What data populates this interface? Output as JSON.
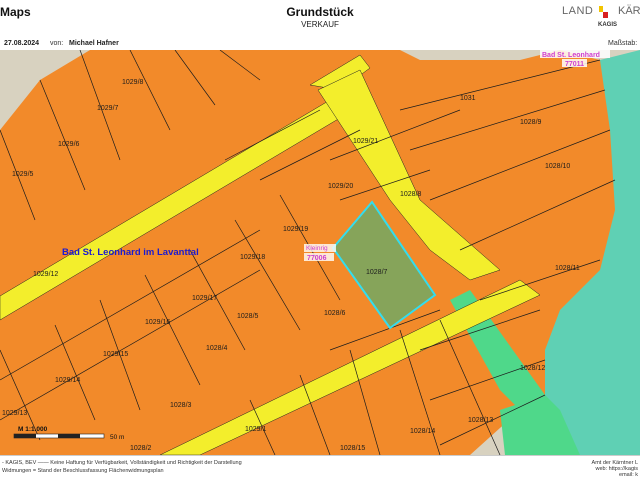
{
  "header": {
    "brand": "Maps",
    "title": "Grundstück",
    "subtitle": "VERKAUF",
    "date": "27.08.2024",
    "author_label": "von:",
    "author": "Michael Hafner",
    "scale_label": "Maßstab:",
    "logo_left": "LAND",
    "logo_right": "KÄR",
    "logo_sub": "KAGIS"
  },
  "map": {
    "town_label": "Bad St. Leonhard im Lavanttal",
    "cadastral_top": {
      "name": "Bad St. Leonhard",
      "code": "77011"
    },
    "cadastral_center": {
      "name": "Kleinrig",
      "code": "77006"
    },
    "selected_parcel": "1028/7",
    "parcels": [
      "1029/8",
      "1029/7",
      "1029/6",
      "1029/5",
      "1031",
      "1028/9",
      "1029/21",
      "1028/10",
      "1029/20",
      "1028/8",
      "1029/19",
      "1029/18",
      "1029/12",
      "1029/17",
      "1028/11",
      "1029/16",
      "1028/5",
      "1028/6",
      "1029/15",
      "1028/4",
      "1029/14",
      "1028/12",
      "1029/13",
      "1028/3",
      "1029/1",
      "1028/14",
      "1028/13",
      "1028/2",
      "1028/15"
    ],
    "scale_text": "M 1:1.000",
    "scale_dist": "50 m",
    "colors": {
      "parcel": "#f28a2a",
      "road": "#f3ee2c",
      "green": "#4fd88a",
      "teal": "#5fd0b4",
      "selected": "#86a45a",
      "selected_border": "#33ddee",
      "boundary": "#1c1c1c",
      "label_magenta": "#d040d0"
    }
  },
  "footer": {
    "left1": "- KAGIS, BEV —— Keine Haftung für Verfügbarkeit, Vollständigkeit und Richtigkeit der Darstellung",
    "left2": "Widmungen = Stand der Beschlussfassung Flächenwidmungsplan",
    "right1": "Amt der Kärntner L",
    "right2": "web: https://kagis",
    "right3": "email: k"
  }
}
